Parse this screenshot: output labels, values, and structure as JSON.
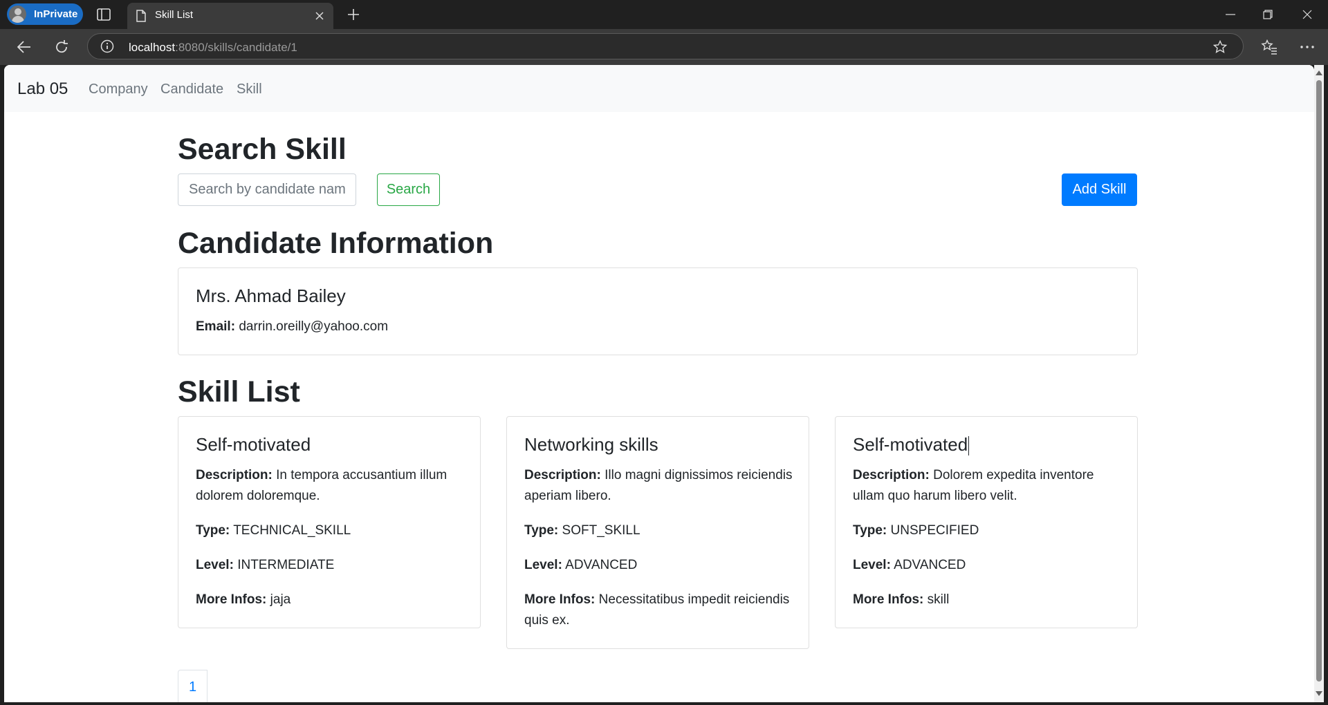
{
  "browser": {
    "profile_label": "InPrivate",
    "tab_title": "Skill List",
    "url_host": "localhost",
    "url_rest": ":8080/skills/candidate/1"
  },
  "navbar": {
    "brand": "Lab 05",
    "links": [
      "Company",
      "Candidate",
      "Skill"
    ]
  },
  "search": {
    "heading": "Search Skill",
    "placeholder": "Search by candidate name",
    "search_label": "Search",
    "add_label": "Add Skill"
  },
  "candidate": {
    "heading": "Candidate Information",
    "name": "Mrs. Ahmad Bailey",
    "email_label": "Email:",
    "email": "darrin.oreilly@yahoo.com"
  },
  "skills": {
    "heading": "Skill List",
    "labels": {
      "description": "Description:",
      "type": "Type:",
      "level": "Level:",
      "more": "More Infos:"
    },
    "items": [
      {
        "name": "Self-motivated",
        "description": "In tempora accusantium illum dolorem doloremque.",
        "type": "TECHNICAL_SKILL",
        "level": "INTERMEDIATE",
        "more": "jaja"
      },
      {
        "name": "Networking skills",
        "description": "Illo magni dignissimos reiciendis aperiam libero.",
        "type": "SOFT_SKILL",
        "level": "ADVANCED",
        "more": "Necessitatibus impedit reiciendis quis ex."
      },
      {
        "name": "Self-motivated",
        "description": "Dolorem expedita inventore ullam quo harum libero velit.",
        "type": "UNSPECIFIED",
        "level": "ADVANCED",
        "more": "skill"
      }
    ]
  },
  "pagination": {
    "pages": [
      "1"
    ]
  }
}
